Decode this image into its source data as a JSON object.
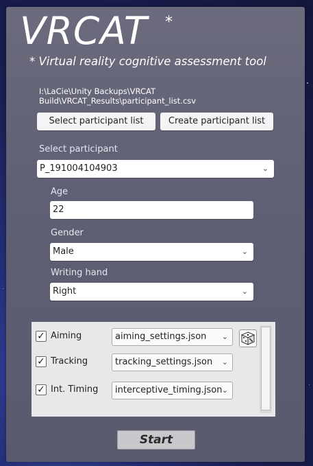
{
  "app": {
    "logo": "VRCAT",
    "logo_star": "*",
    "subtitle": "* Virtual reality cognitive assessment tool"
  },
  "participant_file": {
    "path_line1": "I:\\LaCie\\Unity Backups\\VRCAT",
    "path_line2": "Build\\VRCAT_Results\\participant_list.csv",
    "select_button": "Select participant list",
    "create_button": "Create participant list"
  },
  "participant": {
    "label": "Select participant",
    "selected": "P_191004104903"
  },
  "age": {
    "label": "Age",
    "value": "22"
  },
  "gender": {
    "label": "Gender",
    "selected": "Male"
  },
  "writing_hand": {
    "label": "Writing hand",
    "selected": "Right"
  },
  "tasks": [
    {
      "name": "Aiming",
      "checked": true,
      "settings_file": "aiming_settings.json"
    },
    {
      "name": "Tracking",
      "checked": true,
      "settings_file": "tracking_settings.json"
    },
    {
      "name": "Int. Timing",
      "checked": true,
      "settings_file": "interceptive_timing.json"
    }
  ],
  "start_button": "Start",
  "icons": {
    "chevron": "chevron-down-icon",
    "checkmark": "checkmark-icon",
    "dice": "dice-icon"
  }
}
